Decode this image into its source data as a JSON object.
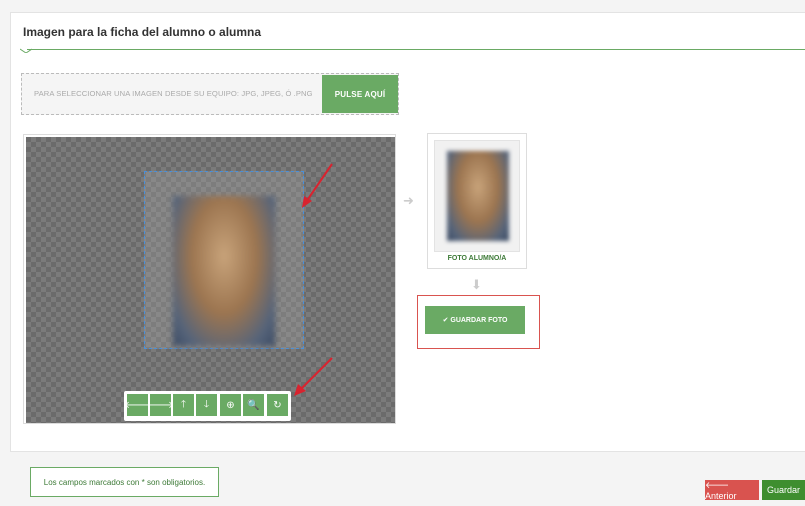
{
  "panel": {
    "title": "Imagen para la ficha del alumno o alumna"
  },
  "file_select": {
    "instruction": "PARA SELECCIONAR UNA IMAGEN DESDE SU EQUIPO: JPG, JPEG, Ó .PNG",
    "button_label": "PULSE AQUÍ"
  },
  "toolbar": {
    "move_left": "🡐",
    "move_right": "🡒",
    "move_up": "🡑",
    "move_down": "🡓",
    "zoom_in": "⊕",
    "zoom_out": "🔍",
    "reset": "↻",
    "icons": [
      "arrow-left-icon",
      "arrow-right-icon",
      "arrow-up-icon",
      "arrow-down-icon",
      "zoom-in-icon",
      "zoom-out-icon",
      "refresh-icon"
    ]
  },
  "flow": {
    "right_arrow": "➜",
    "down_arrow": "⬇"
  },
  "preview": {
    "caption": "FOTO ALUMNO/A",
    "save_label": "✔ GUARDAR FOTO"
  },
  "footer": {
    "notice": "Los campos marcados con * son obligatorios.",
    "prev_label": "🡐 Anterior",
    "save_label": "Guardar"
  },
  "colors": {
    "primary_green": "#6aaa64",
    "dark_green": "#3e8e2f",
    "danger_red": "#d9534f",
    "annotation_red": "#d9232f",
    "selection_blue": "#4a90d9"
  }
}
